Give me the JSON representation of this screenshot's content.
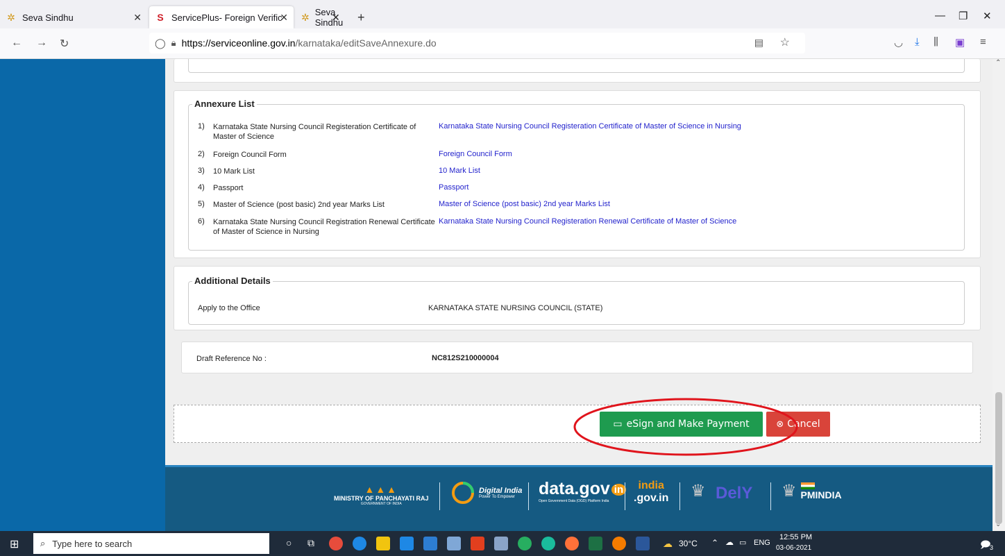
{
  "browser": {
    "tabs": [
      {
        "title": "Seva Sindhu",
        "favicon": "seva-star-icon"
      },
      {
        "title": "ServicePlus- Foreign Verificatio",
        "favicon": "serviceplus-icon"
      },
      {
        "title": "Seva Sindhu",
        "favicon": "seva-star-icon"
      }
    ],
    "url_host": "https://serviceonline.gov.in",
    "url_path": "/karnataka/editSaveAnnexure.do"
  },
  "annexure": {
    "legend": "Annexure List",
    "items": [
      {
        "num": "1)",
        "label": "Karnataka State Nursing Council Registeration Certificate of Master of Science",
        "link": "Karnataka State Nursing Council Registeration Certificate of Master of Science in Nursing"
      },
      {
        "num": "2)",
        "label": "Foreign Council Form",
        "link": "Foreign Council Form"
      },
      {
        "num": "3)",
        "label": "10 Mark List",
        "link": "10 Mark List"
      },
      {
        "num": "4)",
        "label": "Passport",
        "link": "Passport"
      },
      {
        "num": "5)",
        "label": "Master of Science (post basic) 2nd year Marks List",
        "link": "Master of Science (post basic) 2nd year Marks List"
      },
      {
        "num": "6)",
        "label": "Karnataka State Nursing Council Registration Renewal Certificate of Master of Science in Nursing",
        "link": "Karnataka State Nursing Council Registeration Renewal Certificate of Master of Science"
      }
    ]
  },
  "additional": {
    "legend": "Additional Details",
    "office_label": "Apply to the Office",
    "office_value": "KARNATAKA STATE NURSING COUNCIL (STATE)"
  },
  "draft": {
    "label": "Draft Reference No :",
    "value": "NC812S210000004"
  },
  "actions": {
    "esign_label": "eSign and Make Payment",
    "cancel_label": "Cancel"
  },
  "footer": {
    "ministry": "MINISTRY OF PANCHAYATI RAJ",
    "ministry_sub": "GOVERNMENT OF INDIA",
    "digital_india": "Digital India",
    "digital_india_sub": "Power To Empower",
    "datagov": "data.gov",
    "datagov_suffix": "in",
    "datagov_sub": "Open Government Data (OGD) Platform India",
    "indiagov": ".gov.in",
    "indiagov_top": "india",
    "pmindia": "PMINDIA"
  },
  "taskbar": {
    "search_placeholder": "Type here to search",
    "weather": "30°C",
    "lang": "ENG",
    "time": "12:55 PM",
    "date": "03-06-2021",
    "notification_count": "3"
  },
  "colors": {
    "sidebar": "#0a68a8",
    "esign_button": "#1e9b4f",
    "cancel_button": "#d9443a",
    "footer": "#155a82",
    "highlight_ellipse": "#e0141c"
  }
}
